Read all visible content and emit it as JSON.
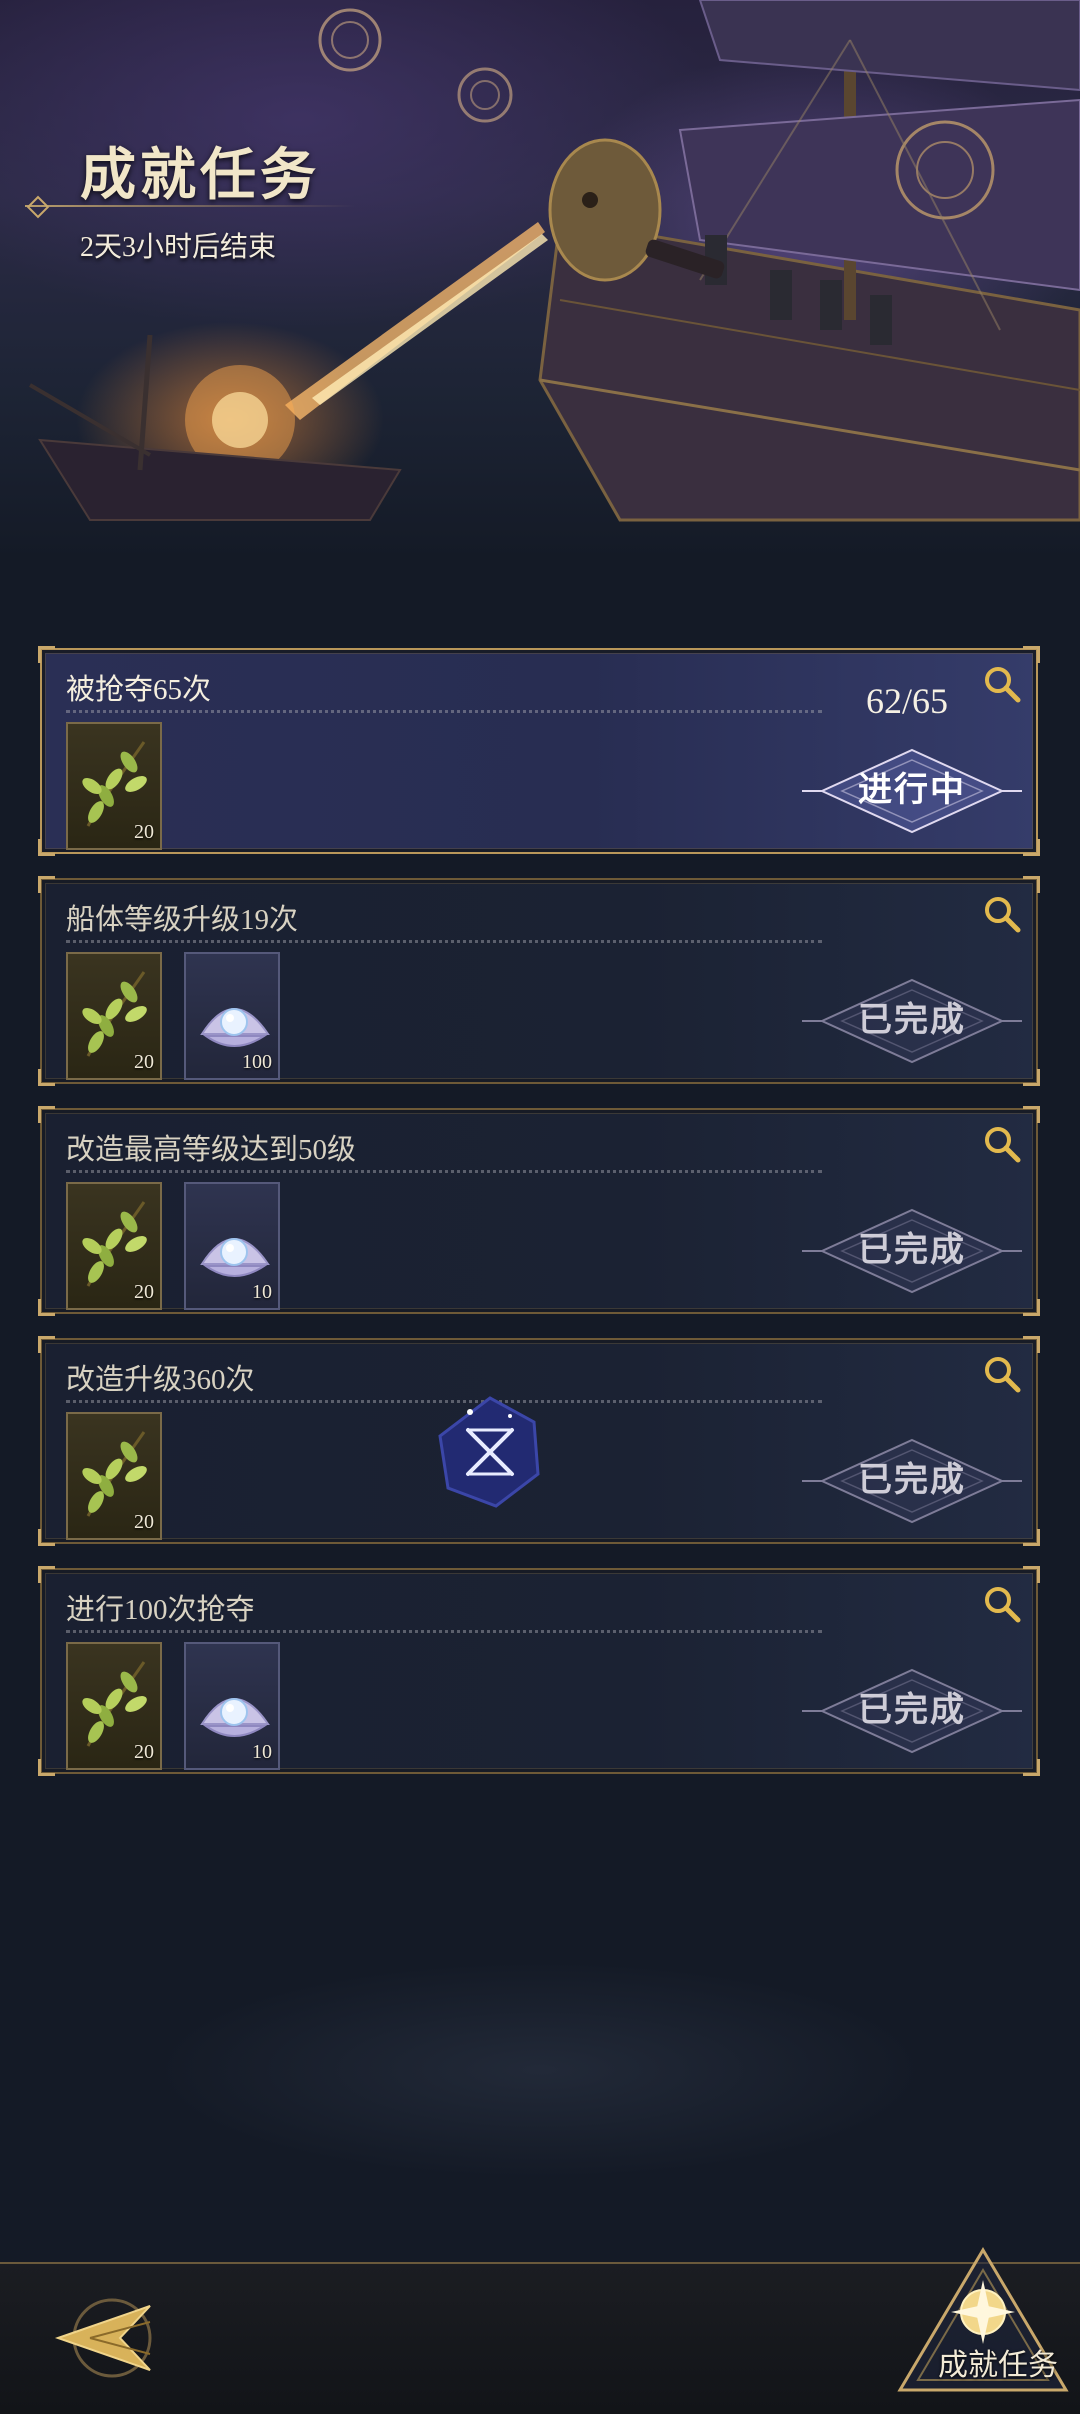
{
  "header": {
    "title": "成就任务",
    "subtitle": "2天3小时后结束"
  },
  "tasks": [
    {
      "title": "被抢夺65次",
      "progress": "62/65",
      "status": "进行中",
      "active": true,
      "rewards": [
        {
          "type": "olive-branch",
          "qty": "20"
        }
      ]
    },
    {
      "title": "船体等级升级19次",
      "progress": "",
      "status": "已完成",
      "active": false,
      "rewards": [
        {
          "type": "olive-branch",
          "qty": "20"
        },
        {
          "type": "pearl-shell",
          "qty": "100"
        }
      ]
    },
    {
      "title": "改造最高等级达到50级",
      "progress": "",
      "status": "已完成",
      "active": false,
      "rewards": [
        {
          "type": "olive-branch",
          "qty": "20"
        },
        {
          "type": "pearl-shell",
          "qty": "10"
        }
      ]
    },
    {
      "title": "改造升级360次",
      "progress": "",
      "status": "已完成",
      "active": false,
      "rewards": [
        {
          "type": "olive-branch",
          "qty": "20"
        }
      ]
    },
    {
      "title": "进行100次抢夺",
      "progress": "",
      "status": "已完成",
      "active": false,
      "rewards": [
        {
          "type": "olive-branch",
          "qty": "20"
        },
        {
          "type": "pearl-shell",
          "qty": "10"
        }
      ]
    }
  ],
  "bottom_nav": {
    "back_icon": "back-arrow-icon",
    "tab_label": "成就任务",
    "tab_icon": "compass-star-icon"
  },
  "colors": {
    "gold_border": "#b9975a",
    "active_card": "#2a2f55",
    "card_bg": "#1a2031"
  }
}
